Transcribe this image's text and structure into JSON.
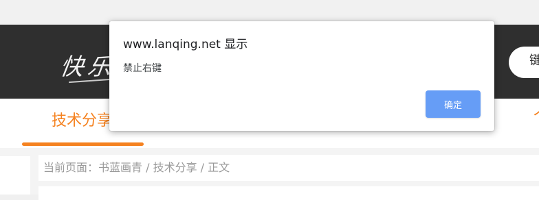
{
  "header": {
    "logo_text": "快乐",
    "search_partial_text": "键"
  },
  "nav": {
    "active_item_label": "技术分享",
    "right_edge_fragment": "个"
  },
  "content": {
    "breadcrumb": "当前页面：书蓝画青 / 技术分享 / 正文"
  },
  "dialog": {
    "title": "www.lanqing.net 显示",
    "message": "禁止右键",
    "ok_label": "确定"
  },
  "colors": {
    "header_bg": "#2f2f2f",
    "accent": "#f58220",
    "button_bg": "#669df6"
  }
}
